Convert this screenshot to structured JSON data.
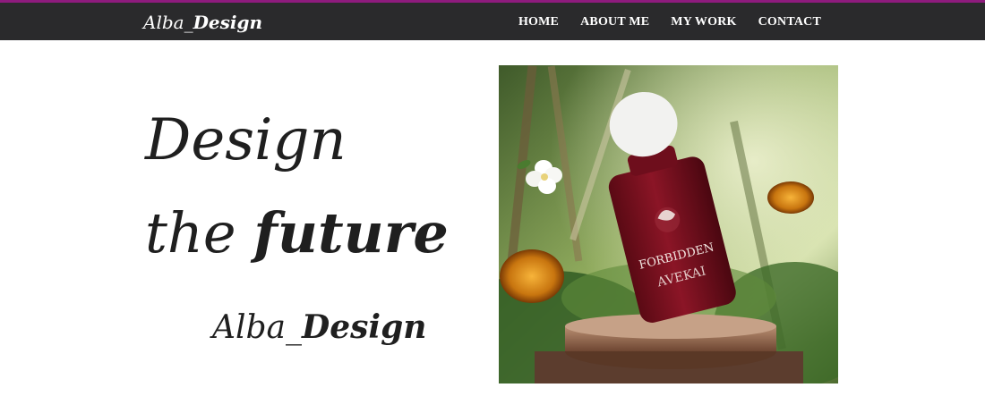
{
  "header": {
    "brand_part1": "Alba_",
    "brand_part2": "Design",
    "nav": [
      {
        "label": "HOME"
      },
      {
        "label": "ABOUT ME"
      },
      {
        "label": "MY WORK"
      },
      {
        "label": "CONTACT"
      }
    ],
    "accent_color": "#8e1b7d",
    "bar_color": "#2a2a2c"
  },
  "hero": {
    "line1": "Design",
    "line2_part1": "the ",
    "line2_part2": "future",
    "signature_part1": "Alba_",
    "signature_part2": "Design"
  },
  "product": {
    "bottle_text_1": "FORBIDDEN",
    "bottle_text_2": "AVEKAI",
    "bottle_color": "#7a0f1e"
  }
}
